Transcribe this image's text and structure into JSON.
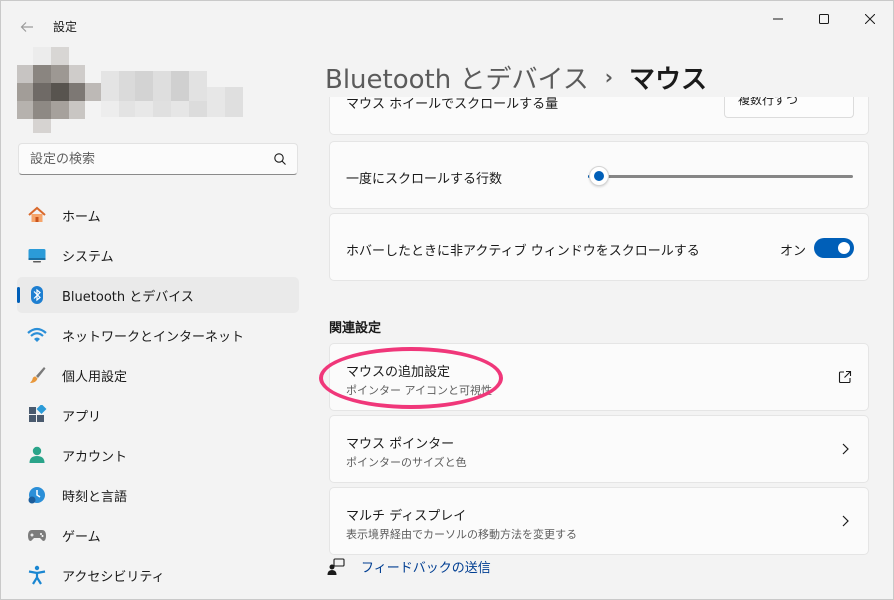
{
  "window": {
    "title": "設定",
    "controls": {
      "minimize": "minimize-icon",
      "maximize": "maximize-icon",
      "close": "close-icon"
    }
  },
  "search": {
    "placeholder": "設定の検索"
  },
  "sidebar": {
    "items": [
      {
        "label": "ホーム",
        "icon": "home-icon",
        "active": false
      },
      {
        "label": "システム",
        "icon": "system-icon",
        "active": false
      },
      {
        "label": "Bluetooth とデバイス",
        "icon": "bluetooth-icon",
        "active": true
      },
      {
        "label": "ネットワークとインターネット",
        "icon": "wifi-icon",
        "active": false
      },
      {
        "label": "個人用設定",
        "icon": "brush-icon",
        "active": false
      },
      {
        "label": "アプリ",
        "icon": "apps-icon",
        "active": false
      },
      {
        "label": "アカウント",
        "icon": "account-icon",
        "active": false
      },
      {
        "label": "時刻と言語",
        "icon": "time-language-icon",
        "active": false
      },
      {
        "label": "ゲーム",
        "icon": "gamepad-icon",
        "active": false
      },
      {
        "label": "アクセシビリティ",
        "icon": "accessibility-icon",
        "active": false
      }
    ]
  },
  "breadcrumb": {
    "parent": "Bluetooth とデバイス",
    "separator": "›",
    "current": "マウス"
  },
  "main": {
    "partial_row": {
      "label": "マウス ホイールでスクロールする量",
      "button": "複数行ずつ"
    },
    "scroll_lines": {
      "label": "一度にスクロールする行数",
      "value_fraction": 0.04
    },
    "inactive_scroll": {
      "label": "ホバーしたときに非アクティブ ウィンドウをスクロールする",
      "state": "オン",
      "on": true
    },
    "related_title": "関連設定",
    "related": [
      {
        "title": "マウスの追加設定",
        "subtitle": "ポインター アイコンと可視性",
        "icon": "external-link-icon"
      },
      {
        "title": "マウス ポインター",
        "subtitle": "ポインターのサイズと色",
        "icon": "chevron-right-icon"
      },
      {
        "title": "マルチ ディスプレイ",
        "subtitle": "表示境界経由でカーソルの移動方法を変更する",
        "icon": "chevron-right-icon"
      }
    ],
    "feedback": "フィードバックの送信"
  },
  "colors": {
    "accent": "#005fb8",
    "highlight": "#f0377a"
  }
}
